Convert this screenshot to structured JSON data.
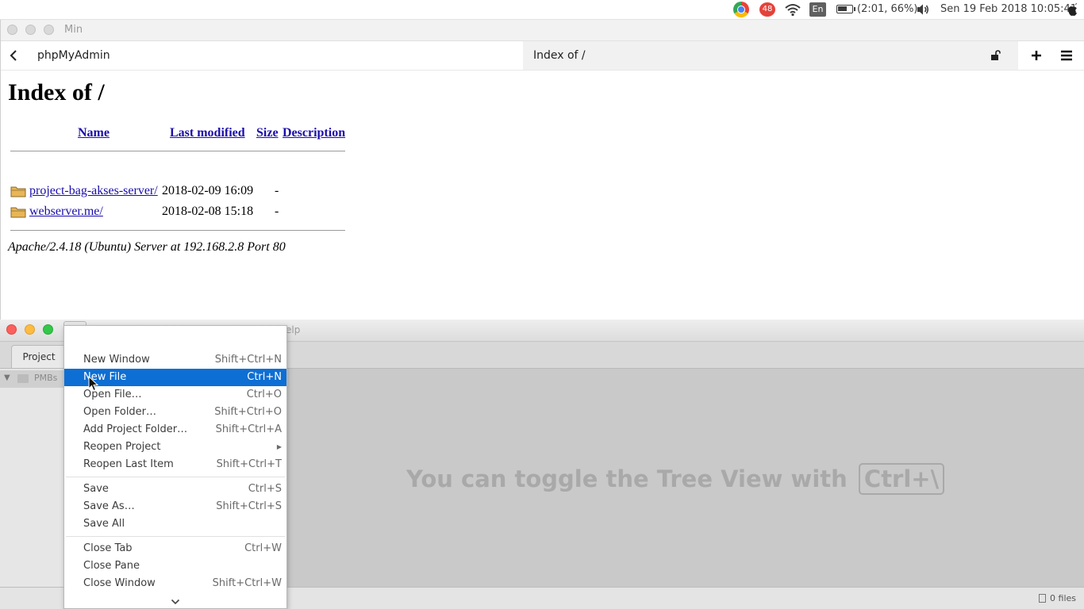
{
  "top_panel": {
    "notification_count": "48",
    "language": "En",
    "battery_text": "(2:01, 66%)",
    "clock": "Sen 19 Feb 2018 10:05:41"
  },
  "browser": {
    "window_title": "Min",
    "tab_left": "phpMyAdmin",
    "tab_right": "Index of /",
    "page": {
      "heading": "Index of /",
      "columns": {
        "name": "Name",
        "last_modified": "Last modified",
        "size": "Size",
        "description": "Description"
      },
      "entries": [
        {
          "name": "project-bag-akses-server/",
          "date": "2018-02-09 16:09",
          "size": "-"
        },
        {
          "name": "webserver.me/",
          "date": "2018-02-08 15:18",
          "size": "-"
        }
      ],
      "address": "Apache/2.4.18 (Ubuntu) Server at 192.168.2.8 Port 80"
    }
  },
  "atom": {
    "title_fragment": "elp",
    "project_tab": "Project",
    "tree_root": "PMBs",
    "editor_message": "You can toggle the Tree View with",
    "editor_shortcut": "Ctrl+\\",
    "status_files": "0 files"
  },
  "file_menu": {
    "items": [
      {
        "label": "New Window",
        "shortcut": "Shift+Ctrl+N"
      },
      {
        "label": "New File",
        "shortcut": "Ctrl+N"
      },
      {
        "label": "Open File…",
        "shortcut": "Ctrl+O"
      },
      {
        "label": "Open Folder…",
        "shortcut": "Shift+Ctrl+O"
      },
      {
        "label": "Add Project Folder…",
        "shortcut": "Shift+Ctrl+A"
      },
      {
        "label": "Reopen Project",
        "shortcut": ""
      },
      {
        "label": "Reopen Last Item",
        "shortcut": "Shift+Ctrl+T"
      },
      {
        "label": "Save",
        "shortcut": "Ctrl+S"
      },
      {
        "label": "Save As…",
        "shortcut": "Shift+Ctrl+S"
      },
      {
        "label": "Save All",
        "shortcut": ""
      },
      {
        "label": "Close Tab",
        "shortcut": "Ctrl+W"
      },
      {
        "label": "Close Pane",
        "shortcut": ""
      },
      {
        "label": "Close Window",
        "shortcut": "Shift+Ctrl+W"
      }
    ],
    "highlighted": "New File"
  },
  "colors": {
    "menu_highlight": "#0d6ed4",
    "link": "#1a0dab",
    "notification": "#e4423a"
  }
}
